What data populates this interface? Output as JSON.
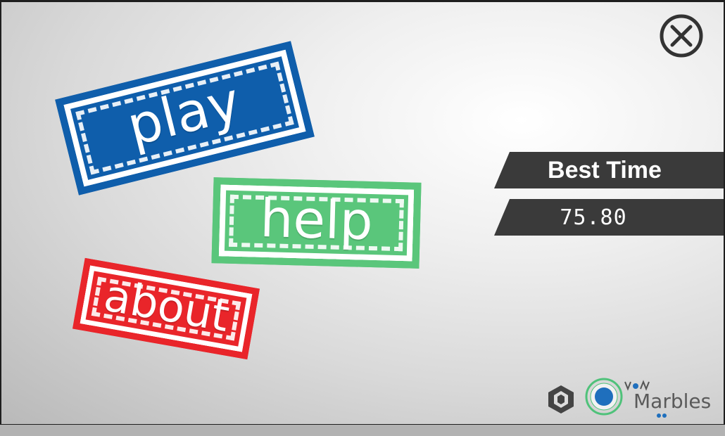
{
  "menu": {
    "play_label": "play",
    "help_label": "help",
    "about_label": "about"
  },
  "best_time": {
    "title": "Best Time",
    "value": "75.80"
  },
  "branding": {
    "marbles_label": "Marbles"
  },
  "icons": {
    "close": "close-icon",
    "unity": "unity-logo-icon",
    "marbles": "marbles-logo-icon"
  },
  "colors": {
    "play": "#0f5eab",
    "help": "#5ac67b",
    "about": "#e9252a",
    "banner": "#3a3a3a"
  }
}
